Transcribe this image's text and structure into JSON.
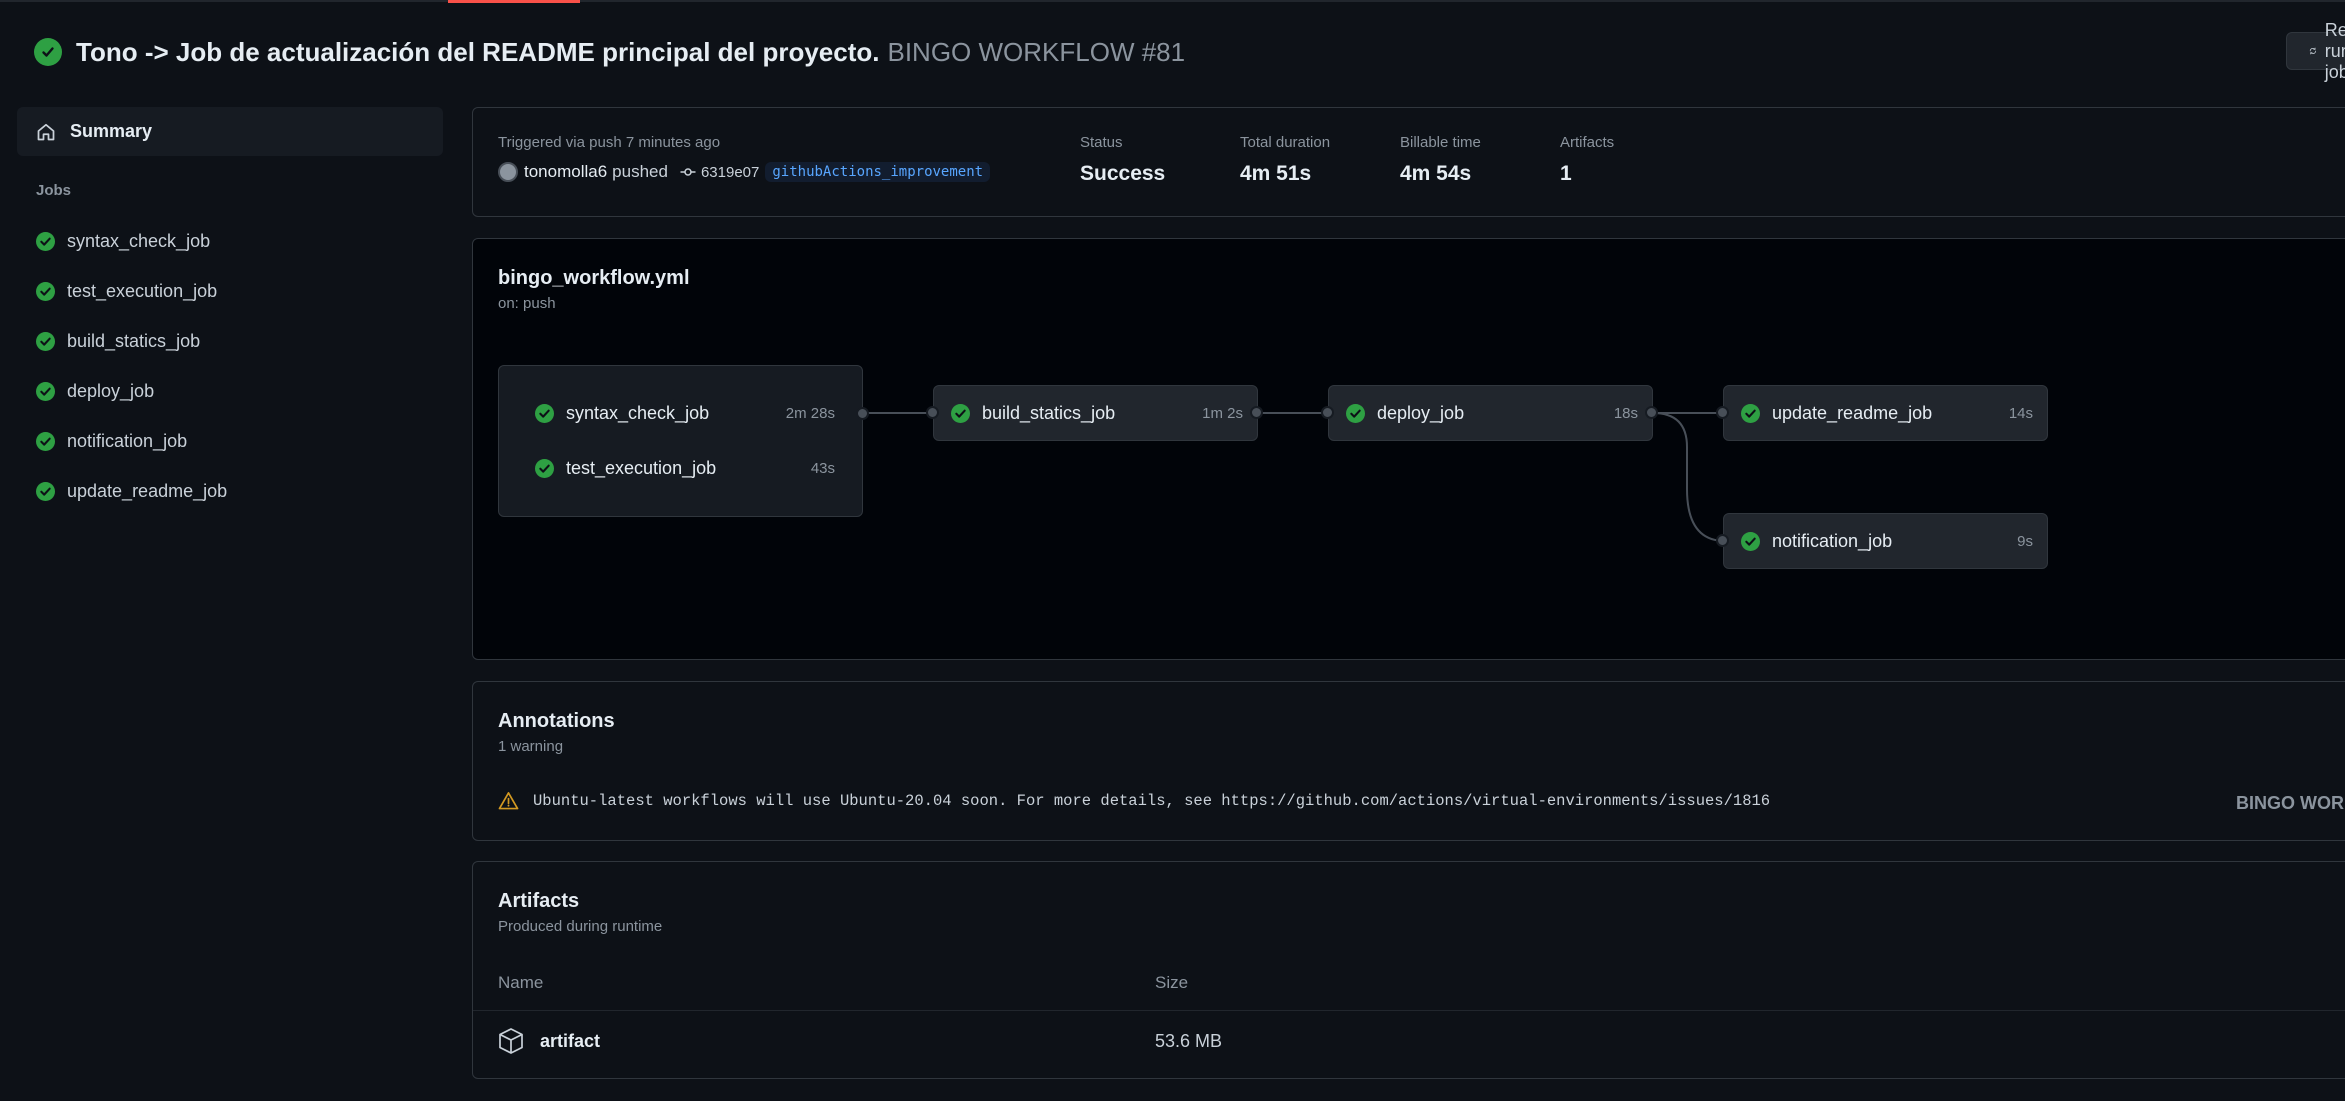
{
  "colors": {
    "success": "#2ea043",
    "warning": "#d29922",
    "link": "#58a6ff",
    "muted": "#8b949e",
    "background": "#0d1117"
  },
  "header": {
    "title": "Tono -> Job de actualización del README principal del proyecto.",
    "run_name": "BINGO WORKFLOW #81",
    "rerun_label": "Re-run all jobs"
  },
  "sidebar": {
    "summary_label": "Summary",
    "jobs_heading": "Jobs",
    "jobs": [
      {
        "label": "syntax_check_job"
      },
      {
        "label": "test_execution_job"
      },
      {
        "label": "build_statics_job"
      },
      {
        "label": "deploy_job"
      },
      {
        "label": "notification_job"
      },
      {
        "label": "update_readme_job"
      }
    ]
  },
  "summary": {
    "trigger": "Triggered via push 7 minutes ago",
    "actor": "tonomolla6",
    "action": "pushed",
    "commit": "6319e07",
    "branch": "githubActions_improvement",
    "stats": [
      {
        "label": "Status",
        "value": "Success"
      },
      {
        "label": "Total duration",
        "value": "4m 51s"
      },
      {
        "label": "Billable time",
        "value": "4m 54s"
      },
      {
        "label": "Artifacts",
        "value": "1"
      }
    ]
  },
  "graph": {
    "file": "bingo_workflow.yml",
    "on": "on: push",
    "jobs": {
      "syntax_check": {
        "name": "syntax_check_job",
        "duration": "2m 28s"
      },
      "test_execution": {
        "name": "test_execution_job",
        "duration": "43s"
      },
      "build_statics": {
        "name": "build_statics_job",
        "duration": "1m 2s"
      },
      "deploy": {
        "name": "deploy_job",
        "duration": "18s"
      },
      "update_readme": {
        "name": "update_readme_job",
        "duration": "14s"
      },
      "notification": {
        "name": "notification_job",
        "duration": "9s"
      }
    }
  },
  "annotations": {
    "title": "Annotations",
    "count": "1 warning",
    "items": [
      {
        "icon": "alert-icon",
        "message": "Ubuntu-latest workflows will use Ubuntu-20.04 soon. For more details, see https://github.com/actions/virtual-environments/issues/1816",
        "source": "BINGO WORKFLOW"
      }
    ]
  },
  "artifacts": {
    "title": "Artifacts",
    "subtitle": "Produced during runtime",
    "columns": {
      "name": "Name",
      "size": "Size"
    },
    "rows": [
      {
        "name": "artifact",
        "size": "53.6 MB"
      }
    ]
  }
}
